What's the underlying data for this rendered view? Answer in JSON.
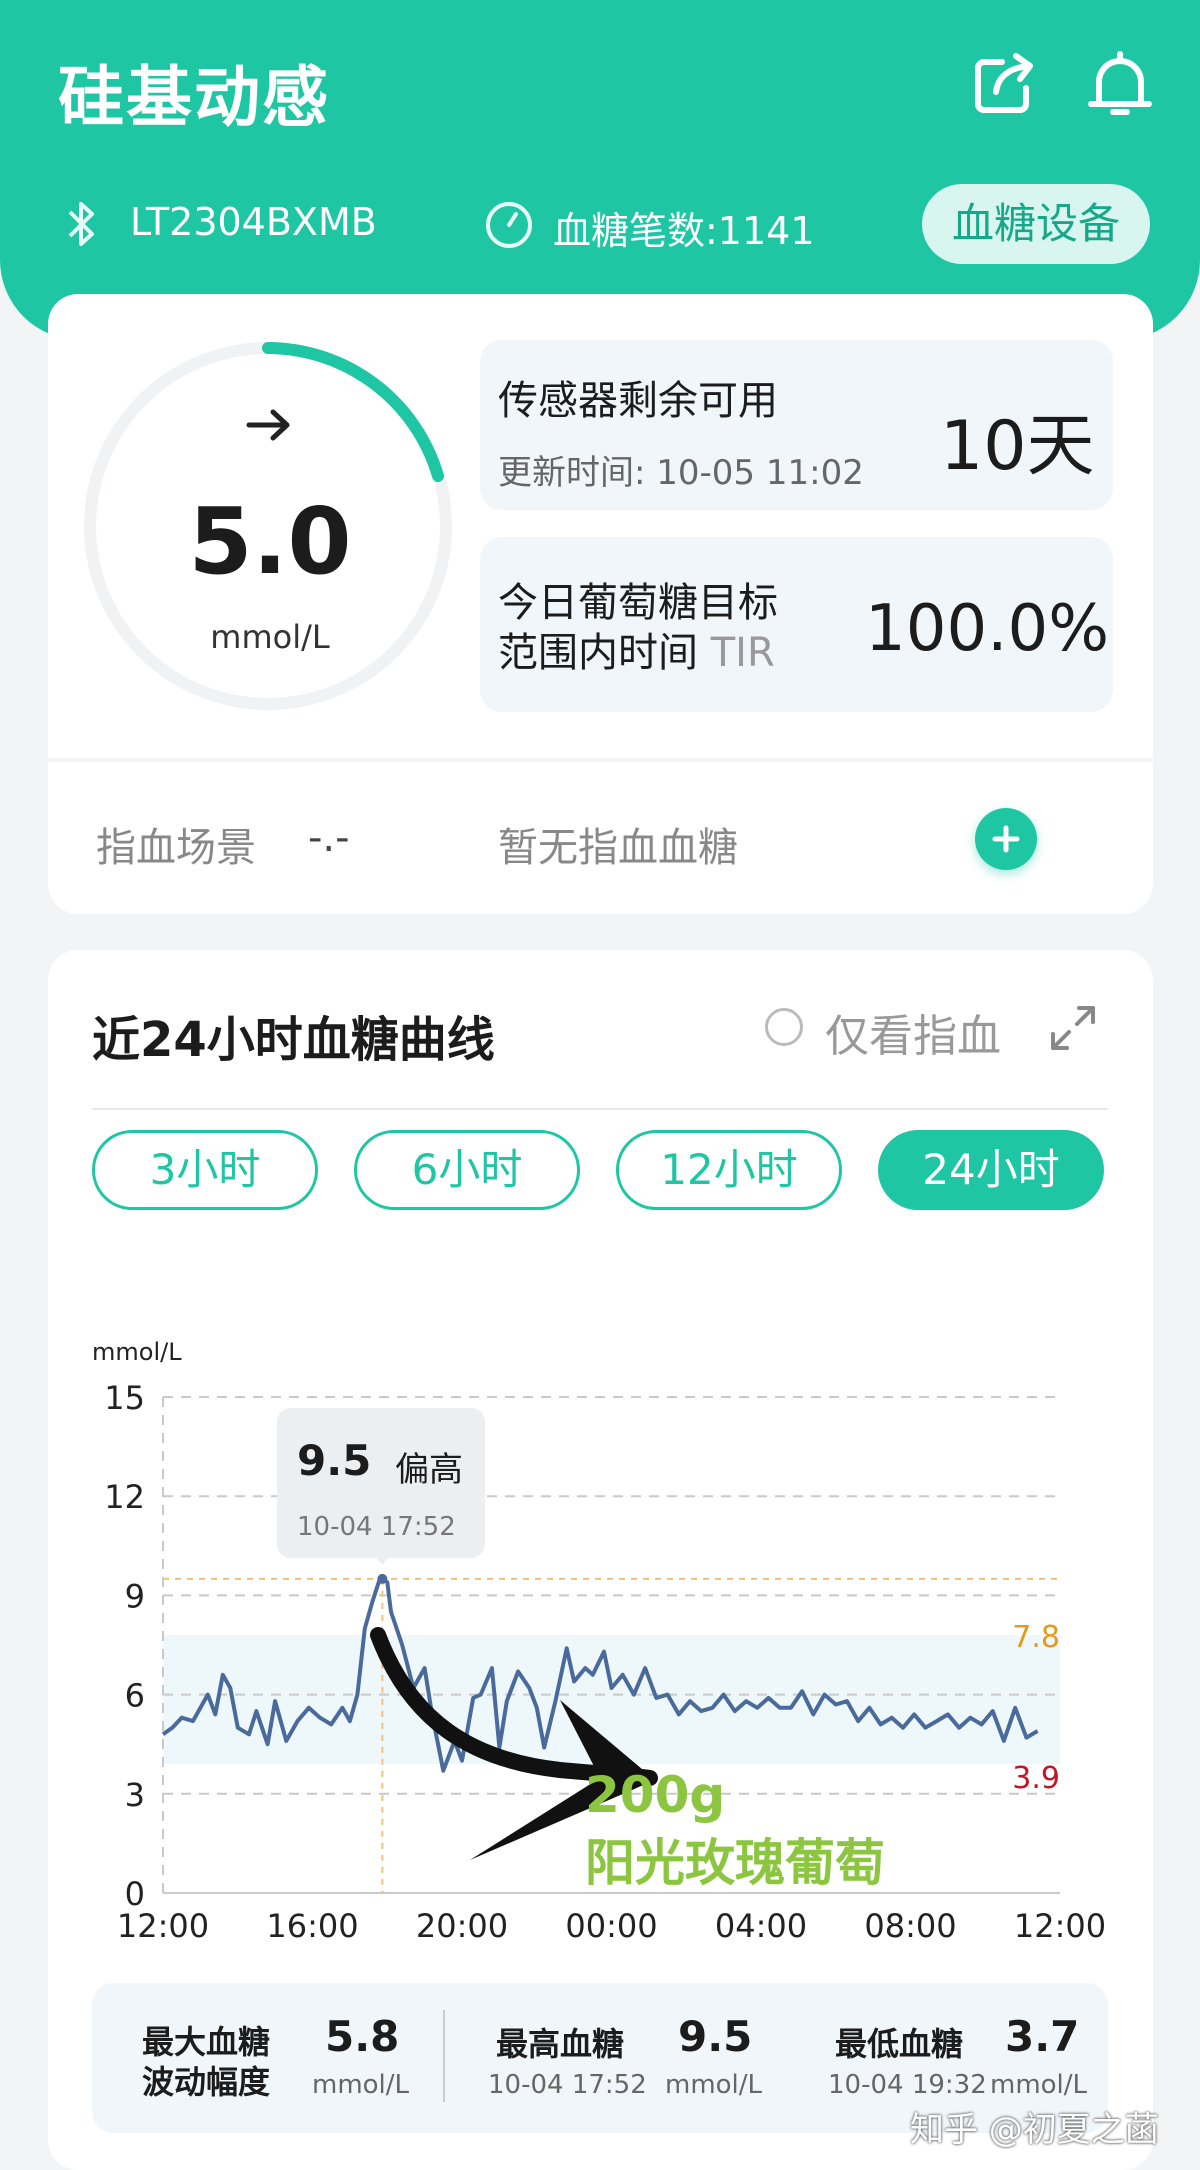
{
  "header": {
    "title": "硅基动感",
    "device_id": "LT2304BXMB",
    "reading_count": "血糖笔数:1141",
    "device_button": "血糖设备"
  },
  "summary": {
    "glucose_value": "5.0",
    "glucose_unit": "mmol/L",
    "trend": "steady",
    "sensor_label": "传感器剩余可用",
    "sensor_updated": "更新时间:  10-05 11:02",
    "sensor_days": "10天",
    "tir_line1": "今日葡萄糖目标",
    "tir_line2": "范围内时间",
    "tir_tag": "TIR",
    "tir_value": "100.0%",
    "finger_label": "指血场景",
    "finger_value": "-.-",
    "finger_empty": "暂无指血血糖"
  },
  "curve": {
    "title": "近24小时血糖曲线",
    "finger_only_label": "仅看指血",
    "tabs": [
      "3小时",
      "6小时",
      "12小时",
      "24小时"
    ],
    "active_tab": "24小时",
    "tooltip": {
      "value": "9.5",
      "status": "偏高",
      "time": "10-04 17:52"
    },
    "annotation_line1": "200g",
    "annotation_line2": "阳光玫瑰葡萄"
  },
  "chart_data": {
    "type": "line",
    "ylabel": "mmol/L",
    "ylim": [
      0,
      15
    ],
    "yticks": [
      "15",
      "12",
      "9",
      "6",
      "3",
      "0"
    ],
    "xticks": [
      "12:00",
      "16:00",
      "20:00",
      "00:00",
      "04:00",
      "08:00",
      "12:00"
    ],
    "xlim_hours": [
      0,
      24
    ],
    "target_range": {
      "low": 3.9,
      "high": 7.8,
      "low_label": "3.9",
      "high_label": "7.8"
    },
    "colors": {
      "line": "#4a6a9c",
      "high": "#e39b1c",
      "low": "#c0152a",
      "band": "#eef8fb"
    },
    "x_hours": [
      0,
      0.25,
      0.5,
      0.8,
      1.0,
      1.2,
      1.4,
      1.6,
      1.8,
      2.0,
      2.3,
      2.5,
      2.8,
      3.0,
      3.3,
      3.6,
      3.9,
      4.2,
      4.5,
      4.8,
      5.0,
      5.2,
      5.4,
      5.6,
      5.8,
      6.0,
      6.1,
      6.4,
      6.7,
      7.0,
      7.2,
      7.5,
      7.8,
      8.0,
      8.3,
      8.5,
      8.8,
      9.0,
      9.2,
      9.5,
      9.8,
      10.0,
      10.2,
      10.5,
      10.8,
      11.0,
      11.3,
      11.5,
      11.8,
      12.0,
      12.3,
      12.6,
      12.9,
      13.2,
      13.5,
      13.8,
      14.1,
      14.4,
      14.7,
      15.0,
      15.3,
      15.6,
      15.9,
      16.2,
      16.5,
      16.8,
      17.1,
      17.4,
      17.7,
      18.0,
      18.3,
      18.6,
      18.9,
      19.2,
      19.5,
      19.8,
      20.1,
      20.4,
      20.7,
      21.0,
      21.3,
      21.6,
      21.9,
      22.2,
      22.5,
      22.8,
      23.1,
      23.4
    ],
    "y_values": [
      4.8,
      5.0,
      5.3,
      5.2,
      5.6,
      6.0,
      5.4,
      6.6,
      6.2,
      5.0,
      4.8,
      5.5,
      4.5,
      5.8,
      4.6,
      5.2,
      5.6,
      5.3,
      5.1,
      5.6,
      5.2,
      6.0,
      8.0,
      8.8,
      9.5,
      9.4,
      8.5,
      7.5,
      6.2,
      6.8,
      5.4,
      3.7,
      4.6,
      4.0,
      5.9,
      6.0,
      6.8,
      4.4,
      5.8,
      6.7,
      6.2,
      5.6,
      4.4,
      5.8,
      7.4,
      6.4,
      6.8,
      6.6,
      7.3,
      6.2,
      6.6,
      6.0,
      6.8,
      5.9,
      6.0,
      5.4,
      5.8,
      5.5,
      5.6,
      6.0,
      5.5,
      5.8,
      5.6,
      5.9,
      5.6,
      5.6,
      6.1,
      5.4,
      6.0,
      5.7,
      5.8,
      5.2,
      5.6,
      5.1,
      5.3,
      5.0,
      5.4,
      5.0,
      5.2,
      5.4,
      5.0,
      5.3,
      5.1,
      5.5,
      4.6,
      5.6,
      4.7,
      4.9
    ],
    "peak": {
      "x_hour": 5.87,
      "y": 9.5
    }
  },
  "stats": {
    "fluct_label1": "最大血糖",
    "fluct_label2": "波动幅度",
    "fluct_value": "5.8",
    "fluct_unit": "mmol/L",
    "max_label": "最高血糖",
    "max_value": "9.5",
    "max_time": "10-04 17:52",
    "max_unit": "mmol/L",
    "min_label": "最低血糖",
    "min_value": "3.7",
    "min_time": "10-04 19:32",
    "min_unit": "mmol/L"
  },
  "watermark": "知乎 @初夏之菡"
}
